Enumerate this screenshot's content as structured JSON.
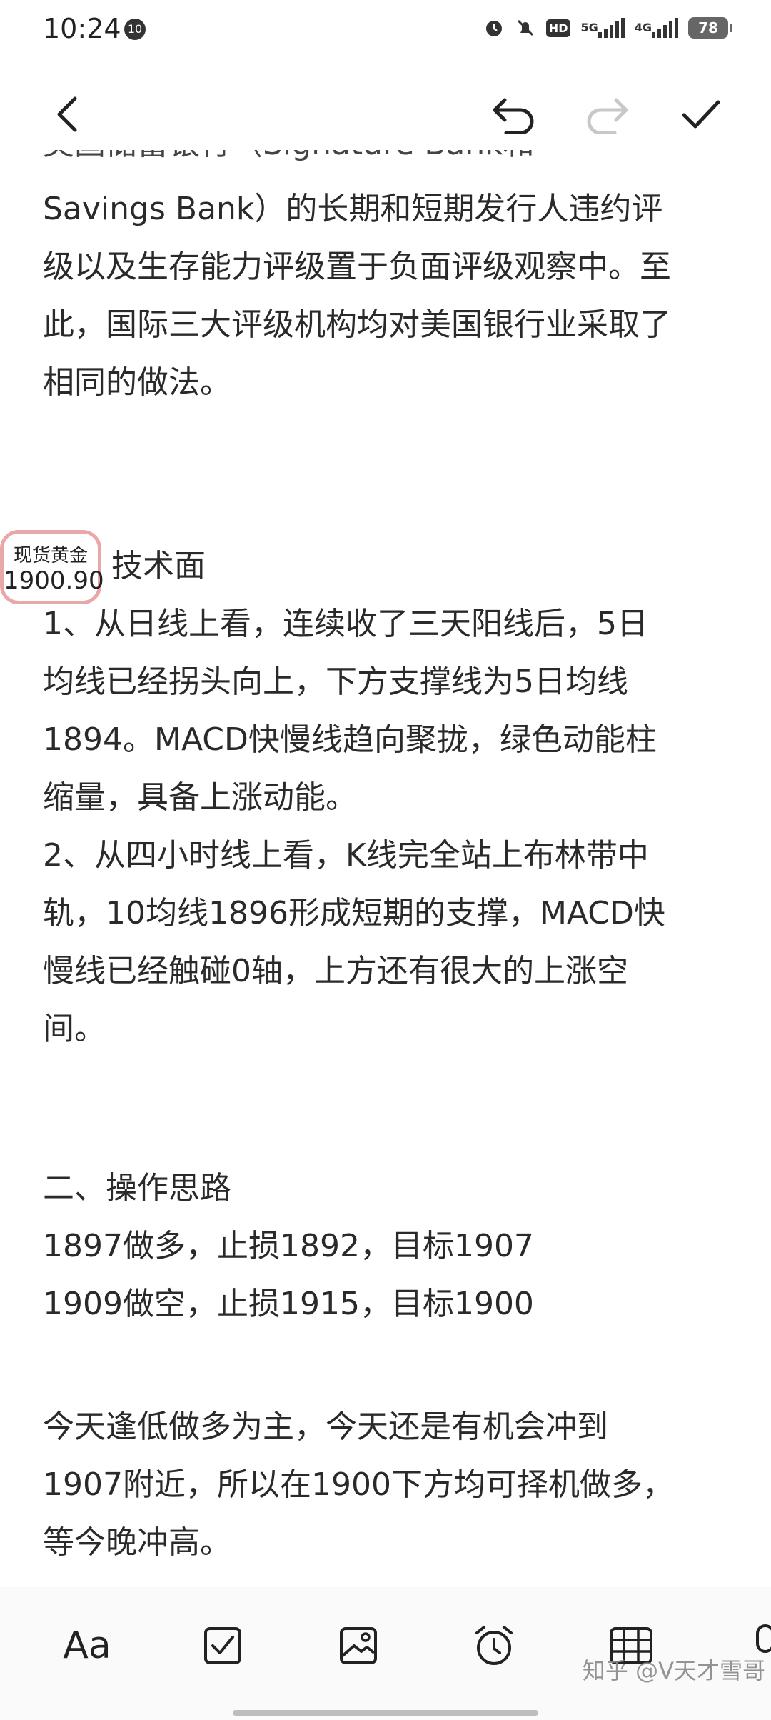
{
  "status_bar": {
    "time": "10:24",
    "notification_badge": "10",
    "hd_label": "HD",
    "net_5g": "5G",
    "net_4g": "4G",
    "battery": "78"
  },
  "toolbar": {
    "back_icon": "chevron-left-icon",
    "undo_icon": "undo-icon",
    "redo_icon": "redo-icon",
    "done_icon": "check-icon"
  },
  "note": {
    "cut_off_line": "美国储蓄银行（Signature Bank和",
    "paragraph_1": [
      "Savings Bank）的长期和短期发行人违约评",
      "级以及生存能力评级置于负面评级观察中。至",
      "此，国际三大评级机构均对美国银行业采取了",
      "相同的做法。"
    ],
    "section_tech_title": "技术面",
    "paragraph_tech": [
      "1、从日线上看，连续收了三天阳线后，5日",
      "均线已经拐头向上，下方支撑线为5日均线",
      "1894。MACD快慢线趋向聚拢，绿色动能柱",
      "缩量，具备上涨动能。",
      "2、从四小时线上看，K线完全站上布林带中",
      "轨，10均线1896形成短期的支撑，MACD快",
      "慢线已经触碰0轴，上方还有很大的上涨空",
      "间。"
    ],
    "section_ops": [
      "二、操作思路",
      "1897做多，止损1892，目标1907",
      "1909做空，止损1915，目标1900"
    ],
    "paragraph_summary": [
      "今天逢低做多为主，今天还是有机会冲到",
      "1907附近，所以在1900下方均可择机做多，",
      "等今晚冲高。"
    ]
  },
  "gold_widget": {
    "title": "现货黄金",
    "price": "1900.90"
  },
  "bottom_bar": {
    "font_label": "Aa",
    "watermark": "知乎 @V天才雪哥"
  }
}
